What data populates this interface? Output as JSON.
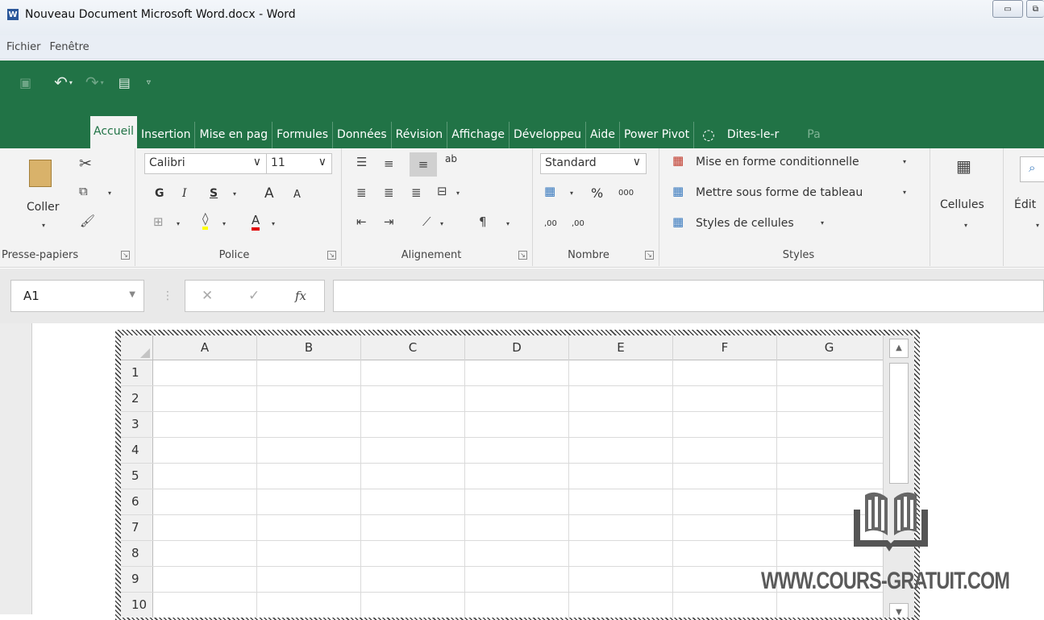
{
  "window": {
    "title": "Nouveau Document Microsoft Word.docx - Word",
    "logo_letter": "W"
  },
  "menubar": {
    "items": [
      "Fichier",
      "Fenêtre"
    ]
  },
  "ribbon_tabs": [
    "Accueil",
    "Insertion",
    "Mise en pag",
    "Formules",
    "Données",
    "Révision",
    "Affichage",
    "Développeu",
    "Aide",
    "Power Pivot",
    "Dites-le-r",
    "Pa"
  ],
  "ribbon": {
    "clipboard": {
      "paste_label": "Coller",
      "group_label": "Presse-papiers"
    },
    "font": {
      "font_name": "Calibri",
      "font_size": "11",
      "bold": "G",
      "italic": "I",
      "underline": "S",
      "grow": "A",
      "shrink": "A",
      "font_color": "A",
      "group_label": "Police"
    },
    "alignment": {
      "wrap": "ab",
      "group_label": "Alignement"
    },
    "number": {
      "format": "Standard",
      "percent": "%",
      "thousands": "000",
      "inc_decimal": ",00",
      "dec_decimal": ",00",
      "group_label": "Nombre"
    },
    "styles": {
      "conditional": "Mise en forme conditionnelle",
      "table": "Mettre sous forme de tableau",
      "cell_styles": "Styles de cellules",
      "group_label": "Styles"
    },
    "cells": {
      "label": "Cellules"
    },
    "editing": {
      "label": "Édit"
    }
  },
  "formula_bar": {
    "name_box": "A1",
    "fx": "fx",
    "value": ""
  },
  "sheet": {
    "columns": [
      "A",
      "B",
      "C",
      "D",
      "E",
      "F",
      "G"
    ],
    "rows": [
      "1",
      "2",
      "3",
      "4",
      "5",
      "6",
      "7",
      "8",
      "9",
      "10"
    ]
  },
  "watermark": {
    "text": "WWW.COURS-GRATUIT.COM"
  },
  "colors": {
    "excel_green": "#217346",
    "ribbon_bg": "#f3f3f3"
  }
}
